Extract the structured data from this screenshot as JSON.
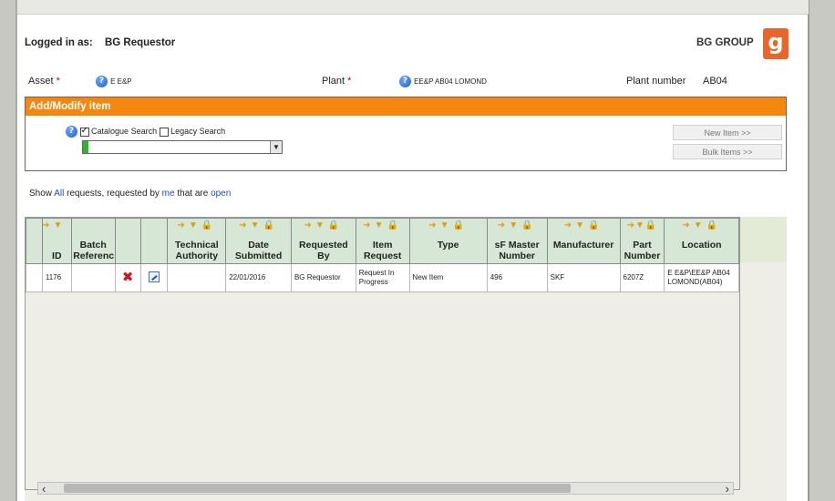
{
  "header": {
    "logged_in_label": "Logged in as:",
    "user": "BG Requestor",
    "brand": "BG GROUP",
    "logo_letter": "g"
  },
  "fields": {
    "asset_label": "Asset",
    "asset_required": "*",
    "asset_value": "E E&P",
    "plant_label": "Plant",
    "plant_required": "*",
    "plant_value": "EE&P AB04 LOMOND",
    "plant_number_label": "Plant number",
    "plant_number_value": "AB04"
  },
  "add_modify": {
    "title": "Add/Modify item",
    "catalogue_search": "Catalogue Search",
    "legacy_search": "Legacy Search",
    "new_item_button": "New Item >>",
    "bulk_items_button": "Bulk Items >>"
  },
  "show_filter": {
    "prefix": "Show",
    "all": "All",
    "mid": "requests, requested by",
    "me": "me",
    "mid2": "that are",
    "open": "open"
  },
  "grid": {
    "columns": [
      {
        "key": "id",
        "label": "ID"
      },
      {
        "key": "batch",
        "label": "Batch Referenc"
      },
      {
        "key": "delete",
        "label": ""
      },
      {
        "key": "edit",
        "label": ""
      },
      {
        "key": "technical_authority",
        "label": "Technical Authority"
      },
      {
        "key": "date_submitted",
        "label": "Date Submitted"
      },
      {
        "key": "requested_by",
        "label": "Requested By"
      },
      {
        "key": "item_request",
        "label": "Item Request"
      },
      {
        "key": "type",
        "label": "Type"
      },
      {
        "key": "sf_master_number",
        "label": "sF Master Number"
      },
      {
        "key": "manufacturer",
        "label": "Manufacturer"
      },
      {
        "key": "part_number",
        "label": "Part Number"
      },
      {
        "key": "location",
        "label": "Location"
      }
    ],
    "rows": [
      {
        "id": "1176",
        "batch": "",
        "technical_authority": "",
        "date_submitted": "22/01/2016",
        "requested_by": "BG Requestor",
        "item_request": "Request In Progress",
        "type": "New Item",
        "sf_master_number": "496",
        "manufacturer": "SKF",
        "part_number": "6207Z",
        "location": "E E&P\\EE&P AB04 LOMOND(AB04)"
      }
    ]
  },
  "icons": {
    "help": "help-icon",
    "sort": "sort-arrow-icon",
    "filter": "funnel-icon",
    "lock": "lock-icon",
    "delete": "red-x-icon",
    "edit": "edit-icon",
    "refresh": "refresh-icon"
  },
  "colors": {
    "section_header": "#f4880f",
    "grid_header": "#d6e8d5",
    "logo": "#e8662a",
    "link": "#1d4fbf"
  }
}
